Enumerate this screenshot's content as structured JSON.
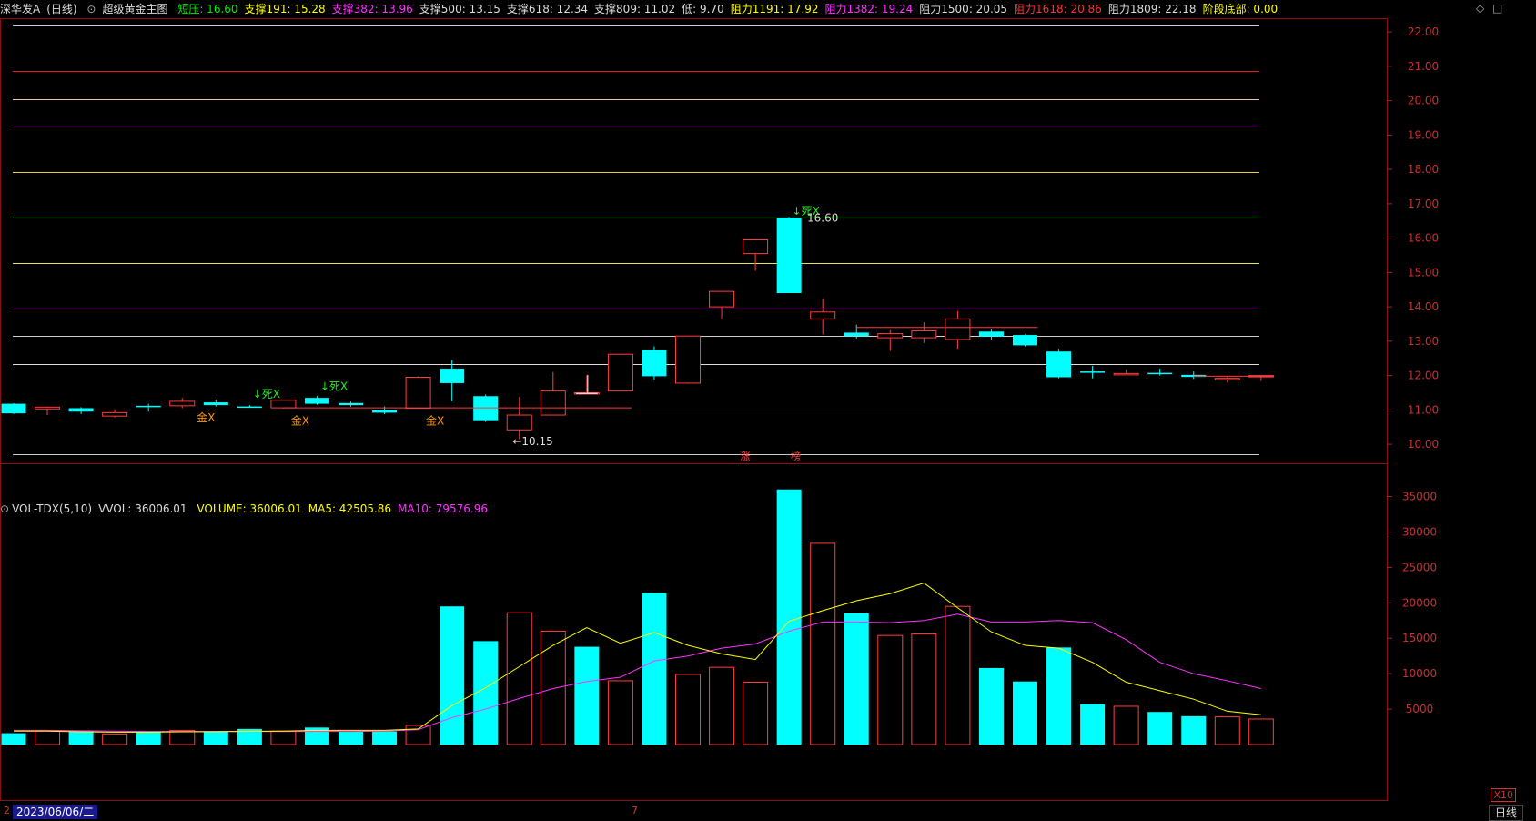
{
  "header": {
    "stock_name": "深华发A",
    "period": "(日线)",
    "indicator": "超级黄金主图",
    "items": [
      {
        "label": "短压: 16.60",
        "color": "#00ee00"
      },
      {
        "label": "支撑191: 15.28",
        "color": "#ffff00"
      },
      {
        "label": "支撑382: 13.96",
        "color": "#ff33ff"
      },
      {
        "label": "支撑500: 13.15",
        "color": "#dddddd"
      },
      {
        "label": "支撑618: 12.34",
        "color": "#dddddd"
      },
      {
        "label": "支撑809: 11.02",
        "color": "#dddddd"
      },
      {
        "label": "低: 9.70",
        "color": "#dddddd"
      },
      {
        "label": "阻力1191: 17.92",
        "color": "#ffff00"
      },
      {
        "label": "阻力1382: 19.24",
        "color": "#ff33ff"
      },
      {
        "label": "阻力1500: 20.05",
        "color": "#dddddd"
      },
      {
        "label": "阻力1618: 20.86",
        "color": "#ff3333"
      },
      {
        "label": "阻力1809: 22.18",
        "color": "#dddddd"
      },
      {
        "label": "阶段底部: 0.00",
        "color": "#ffff00"
      }
    ]
  },
  "volume_header": {
    "title": "VOL-TDX(5,10)",
    "vvol": "VVOL: 36006.01",
    "items": [
      {
        "label": "VOLUME: 36006.01",
        "color": "#ffff00"
      },
      {
        "label": "MA5: 42505.86",
        "color": "#ffff00"
      },
      {
        "label": "MA10: 79576.96",
        "color": "#ff33ff"
      }
    ]
  },
  "price_axis": {
    "min": 9.5,
    "max": 22.4,
    "ticks": [
      "10.00",
      "11.00",
      "12.00",
      "13.00",
      "14.00",
      "15.00",
      "16.00",
      "17.00",
      "18.00",
      "19.00",
      "20.00",
      "21.00",
      "22.00"
    ]
  },
  "volume_axis": {
    "max": 37000,
    "ticks": [
      "5000",
      "10000",
      "15000",
      "20000",
      "25000",
      "30000",
      "35000"
    ]
  },
  "levels": [
    {
      "value": 22.18,
      "color": "#cccccc"
    },
    {
      "value": 20.86,
      "color": "#dd2222"
    },
    {
      "value": 20.05,
      "color": "#e8c8a0"
    },
    {
      "value": 19.24,
      "color": "#cc33cc"
    },
    {
      "value": 17.92,
      "color": "#e8d040"
    },
    {
      "value": 16.6,
      "color": "#22cc22"
    },
    {
      "value": 15.28,
      "color": "#e8e060"
    },
    {
      "value": 13.96,
      "color": "#cc33cc"
    },
    {
      "value": 13.15,
      "color": "#cccccc"
    },
    {
      "value": 12.34,
      "color": "#dddddd"
    },
    {
      "value": 11.02,
      "color": "#dddddd"
    },
    {
      "value": 9.7,
      "color": "#cccccc"
    }
  ],
  "chart_data": {
    "type": "candlestick",
    "up_color": "#ff3c3c",
    "down_color": "#00ffff",
    "candles": [
      {
        "o": 11.18,
        "h": 11.2,
        "l": 10.88,
        "c": 10.9
      },
      {
        "o": 11.03,
        "h": 11.1,
        "l": 10.85,
        "c": 11.08
      },
      {
        "o": 11.05,
        "h": 11.08,
        "l": 10.88,
        "c": 10.95
      },
      {
        "o": 10.82,
        "h": 11.02,
        "l": 10.78,
        "c": 10.92
      },
      {
        "o": 11.12,
        "h": 11.18,
        "l": 10.95,
        "c": 11.1
      },
      {
        "o": 11.12,
        "h": 11.35,
        "l": 11.05,
        "c": 11.25
      },
      {
        "o": 11.22,
        "h": 11.3,
        "l": 11.1,
        "c": 11.14
      },
      {
        "o": 11.1,
        "h": 11.14,
        "l": 11.06,
        "c": 11.08
      },
      {
        "o": 11.06,
        "h": 11.1,
        "l": 11.04,
        "c": 11.28
      },
      {
        "o": 11.35,
        "h": 11.4,
        "l": 11.15,
        "c": 11.18
      },
      {
        "o": 11.2,
        "h": 11.24,
        "l": 11.1,
        "c": 11.14
      },
      {
        "o": 11.0,
        "h": 11.1,
        "l": 10.88,
        "c": 10.92
      },
      {
        "o": 11.05,
        "h": 11.98,
        "l": 11.05,
        "c": 11.95
      },
      {
        "o": 12.2,
        "h": 12.45,
        "l": 11.25,
        "c": 11.78
      },
      {
        "o": 11.4,
        "h": 11.45,
        "l": 10.65,
        "c": 10.7
      },
      {
        "o": 10.42,
        "h": 11.38,
        "l": 10.15,
        "c": 10.85
      },
      {
        "o": 10.85,
        "h": 12.1,
        "l": 10.85,
        "c": 11.55
      },
      {
        "o": 11.5,
        "h": 12.0,
        "l": 11.48,
        "c": 11.5
      },
      {
        "o": 11.55,
        "h": 12.62,
        "l": 11.55,
        "c": 12.62
      },
      {
        "o": 12.75,
        "h": 12.85,
        "l": 11.88,
        "c": 11.98
      },
      {
        "o": 11.78,
        "h": 13.15,
        "l": 11.76,
        "c": 13.15
      },
      {
        "o": 14.0,
        "h": 14.45,
        "l": 13.65,
        "c": 14.45
      },
      {
        "o": 15.55,
        "h": 15.95,
        "l": 15.05,
        "c": 15.95
      },
      {
        "o": 16.6,
        "h": 16.62,
        "l": 14.4,
        "c": 14.4
      },
      {
        "o": 13.65,
        "h": 14.25,
        "l": 13.2,
        "c": 13.85
      },
      {
        "o": 13.25,
        "h": 13.48,
        "l": 13.08,
        "c": 13.15
      },
      {
        "o": 13.1,
        "h": 13.32,
        "l": 12.72,
        "c": 13.22
      },
      {
        "o": 13.1,
        "h": 13.55,
        "l": 12.95,
        "c": 13.3
      },
      {
        "o": 13.05,
        "h": 13.88,
        "l": 12.78,
        "c": 13.65
      },
      {
        "o": 13.28,
        "h": 13.35,
        "l": 13.02,
        "c": 13.14
      },
      {
        "o": 13.18,
        "h": 13.2,
        "l": 12.85,
        "c": 12.88
      },
      {
        "o": 12.7,
        "h": 12.78,
        "l": 11.92,
        "c": 11.95
      },
      {
        "o": 12.12,
        "h": 12.28,
        "l": 11.92,
        "c": 12.08
      },
      {
        "o": 12.05,
        "h": 12.18,
        "l": 12.02,
        "c": 12.06
      },
      {
        "o": 12.08,
        "h": 12.2,
        "l": 12.0,
        "c": 12.04
      },
      {
        "o": 12.02,
        "h": 12.12,
        "l": 11.9,
        "c": 11.96
      },
      {
        "o": 11.9,
        "h": 11.96,
        "l": 11.8,
        "c": 11.92
      },
      {
        "o": 11.96,
        "h": 12.02,
        "l": 11.84,
        "c": 12.0
      }
    ],
    "volume": [
      1600,
      1950,
      1900,
      1500,
      1800,
      2000,
      1900,
      2200,
      1900,
      2400,
      1850,
      1850,
      2700,
      19500,
      14600,
      18600,
      16000,
      13800,
      9000,
      21400,
      9900,
      10900,
      8800,
      36006,
      28400,
      18500,
      15400,
      15600,
      19500,
      10800,
      8900,
      13700,
      5700,
      5400,
      4600,
      4000,
      3900,
      3600
    ],
    "volume_dir": [
      "down",
      "up",
      "down",
      "up",
      "down",
      "up",
      "down",
      "down",
      "up",
      "down",
      "down",
      "down",
      "up",
      "down",
      "down",
      "up",
      "up",
      "down",
      "up",
      "down",
      "up",
      "up",
      "up",
      "down",
      "up",
      "down",
      "up",
      "up",
      "up",
      "down",
      "down",
      "down",
      "down",
      "up",
      "down",
      "down",
      "up",
      "up"
    ],
    "ma5": [
      1900,
      1900,
      1800,
      1750,
      1750,
      1800,
      1820,
      1860,
      1900,
      2000,
      2000,
      2000,
      2200,
      5500,
      8000,
      11000,
      14000,
      16500,
      14300,
      15800,
      14000,
      12800,
      12000,
      17400,
      18900,
      20300,
      21300,
      22800,
      19300,
      15900,
      14000,
      13600,
      11600,
      8800,
      7600,
      6400,
      4700,
      4200
    ],
    "ma10": [
      2000,
      2000,
      1950,
      1900,
      1850,
      1850,
      1850,
      1850,
      1850,
      1850,
      1850,
      1900,
      2100,
      3800,
      5000,
      6500,
      7900,
      8900,
      9500,
      11800,
      12500,
      13600,
      14200,
      16000,
      17300,
      17300,
      17200,
      17500,
      18400,
      17300,
      17300,
      17500,
      17200,
      14800,
      11600,
      10000,
      9000,
      7900
    ],
    "annotations": [
      {
        "text": "金X",
        "index": 5.7,
        "value": 10.67,
        "color": "#ff9900"
      },
      {
        "text": "金X",
        "index": 8.5,
        "value": 10.57,
        "color": "#ff9900"
      },
      {
        "text": "金X",
        "index": 12.5,
        "value": 10.57,
        "color": "#ff9900"
      },
      {
        "text": "↓死X",
        "index": 7.5,
        "value": 11.35,
        "color": "#22ee22"
      },
      {
        "text": "↓死X",
        "index": 9.5,
        "value": 11.58,
        "color": "#22ee22"
      },
      {
        "text": "↓死X",
        "index": 23.5,
        "value": 16.68,
        "color": "#22ee22"
      },
      {
        "text": "16.60",
        "index": 24.0,
        "value": 16.48,
        "color": "#dddddd"
      },
      {
        "text": "←10.15",
        "index": 15.4,
        "value": 9.98,
        "color": "#dddddd"
      }
    ],
    "zhang_labels": [
      "涨",
      "榜"
    ]
  },
  "footer": {
    "date": "2023/06/06/二",
    "marker_left": "2",
    "marker_mid": "7",
    "tab": "日线",
    "scale_label": "X10"
  },
  "controls": {
    "diamond": "◇",
    "restore": "□"
  }
}
